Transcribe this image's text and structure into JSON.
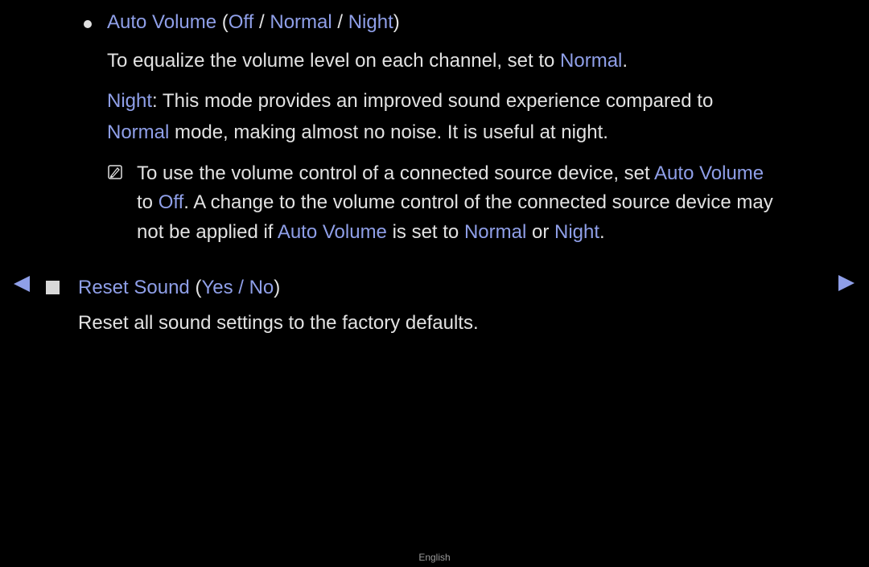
{
  "colors": {
    "background": "#000000",
    "body_text": "#e2e2e2",
    "accent": "#8f9fe8"
  },
  "auto_volume": {
    "bullet_icon": "bullet-dot-icon",
    "title": "Auto Volume",
    "open_paren": "(",
    "options": [
      "Off",
      "Normal",
      "Night"
    ],
    "separator": " / ",
    "close_paren": ")",
    "description_1_prefix": "To equalize the volume level on each channel, set to ",
    "description_1_term": "Normal",
    "description_1_suffix": ".",
    "night_term": "Night",
    "night_line_1": ": This mode provides an improved sound experience compared to",
    "night_line_2_term": "Normal",
    "night_line_2": " mode, making almost no noise. It is useful at night.",
    "note": {
      "icon": "note-icon",
      "line_1_prefix": "To use the volume control of a connected source device, set ",
      "line_1_term": "Auto Volume",
      "line_2_prefix": "to ",
      "line_2_term": "Off",
      "line_2_suffix": ". A change to the volume control of the connected source device may",
      "line_3_prefix": "not be applied if ",
      "line_3_term_1": "Auto Volume",
      "line_3_mid": " is set to ",
      "line_3_term_2": "Normal",
      "line_3_or": " or ",
      "line_3_term_3": "Night",
      "line_3_suffix": "."
    }
  },
  "reset_sound": {
    "bullet_icon": "square-bullet-icon",
    "title": "Reset Sound",
    "open_paren": "(",
    "options_text": "Yes / No",
    "close_paren": ")",
    "description": "Reset all sound settings to the factory defaults."
  },
  "navigation": {
    "prev_icon": "triangle-left-icon",
    "next_icon": "triangle-right-icon"
  },
  "footer": {
    "language": "English"
  }
}
